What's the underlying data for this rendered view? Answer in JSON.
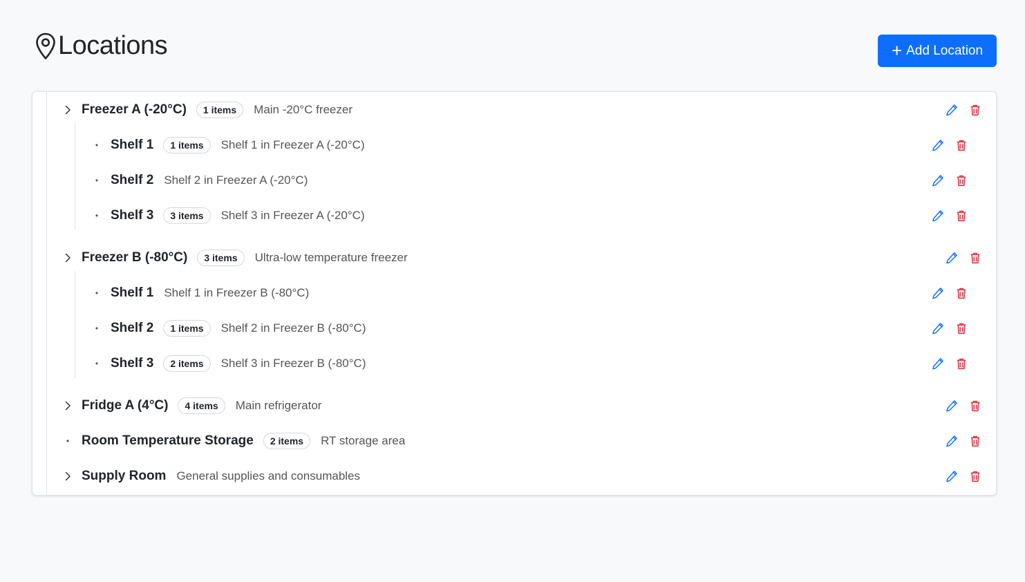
{
  "header": {
    "title": "Locations",
    "add_button": "Add Location"
  },
  "colors": {
    "primary": "#0d6efd",
    "danger": "#dc3545",
    "edit": "#0d6efd"
  },
  "locations": [
    {
      "name": "Freezer A (-20°C)",
      "badge": "1 items",
      "description": "Main -20°C freezer",
      "expandable": true,
      "children": [
        {
          "name": "Shelf 1",
          "badge": "1 items",
          "description": "Shelf 1 in Freezer A (-20°C)"
        },
        {
          "name": "Shelf 2",
          "badge": "",
          "description": "Shelf 2 in Freezer A (-20°C)"
        },
        {
          "name": "Shelf 3",
          "badge": "3 items",
          "description": "Shelf 3 in Freezer A (-20°C)"
        }
      ]
    },
    {
      "name": "Freezer B (-80°C)",
      "badge": "3 items",
      "description": "Ultra-low temperature freezer",
      "expandable": true,
      "children": [
        {
          "name": "Shelf 1",
          "badge": "",
          "description": "Shelf 1 in Freezer B (-80°C)"
        },
        {
          "name": "Shelf 2",
          "badge": "1 items",
          "description": "Shelf 2 in Freezer B (-80°C)"
        },
        {
          "name": "Shelf 3",
          "badge": "2 items",
          "description": "Shelf 3 in Freezer B (-80°C)"
        }
      ]
    },
    {
      "name": "Fridge A (4°C)",
      "badge": "4 items",
      "description": "Main refrigerator",
      "expandable": true,
      "children": []
    },
    {
      "name": "Room Temperature Storage",
      "badge": "2 items",
      "description": "RT storage area",
      "expandable": false,
      "children": []
    },
    {
      "name": "Supply Room",
      "badge": "",
      "description": "General supplies and consumables",
      "expandable": true,
      "children": []
    }
  ]
}
